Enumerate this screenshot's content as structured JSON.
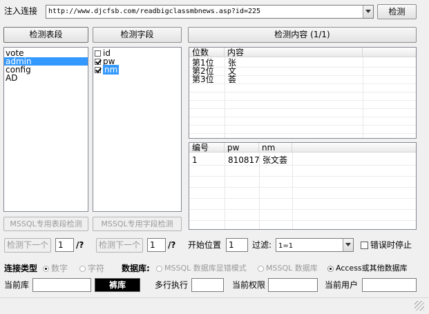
{
  "top": {
    "inject_label": "注入连接",
    "url": "http://www.djcfsb.com/readbigclassmbnews.asp?id=225",
    "detect_button": "检测"
  },
  "tables_panel": {
    "header": "检测表段",
    "items": [
      "vote",
      "admin",
      "config",
      "AD"
    ],
    "selected": "admin",
    "mssql_button": "MSSQL专用表段检测"
  },
  "fields_panel": {
    "header": "检测字段",
    "items": [
      {
        "label": "id",
        "checked": false
      },
      {
        "label": "pw",
        "checked": true
      },
      {
        "label": "nm",
        "checked": true
      }
    ],
    "selected": "nm",
    "mssql_button": "MSSQL专用字段检测"
  },
  "content_panel": {
    "header": "检测内容 (1/1)",
    "grid1": {
      "columns": [
        "位数",
        "内容"
      ],
      "rows": [
        [
          "第1位",
          "张"
        ],
        [
          "第2位",
          "文"
        ],
        [
          "第3位",
          "荟"
        ]
      ]
    },
    "grid2": {
      "columns": [
        "编号",
        "pw",
        "nm"
      ],
      "rows": [
        [
          "1",
          "810817",
          "张文荟"
        ]
      ]
    }
  },
  "nav": {
    "next1_button": "检测下一个",
    "next1_value": "1",
    "next1_suffix": "/?",
    "next2_button": "检测下一个",
    "next2_value": "1",
    "next2_suffix": "/?",
    "start_label": "开始位置",
    "start_value": "1",
    "filter_label": "过滤:",
    "filter_value": "1=1",
    "error_stop_label": "错误时停止"
  },
  "conn": {
    "type_label": "连接类型",
    "opt_number": "数字",
    "opt_char": "字符",
    "db_label": "数据库:",
    "opt_mssql_err": "MSSQL 数据库显错模式",
    "opt_mssql": "MSSQL 数据库",
    "opt_access": "Access或其他数据库"
  },
  "bottom": {
    "current_db_label": "当前库",
    "black_button": "裤库",
    "multi_exec_label": "多行执行",
    "current_perm_label": "当前权限",
    "current_user_label": "当前用户"
  }
}
